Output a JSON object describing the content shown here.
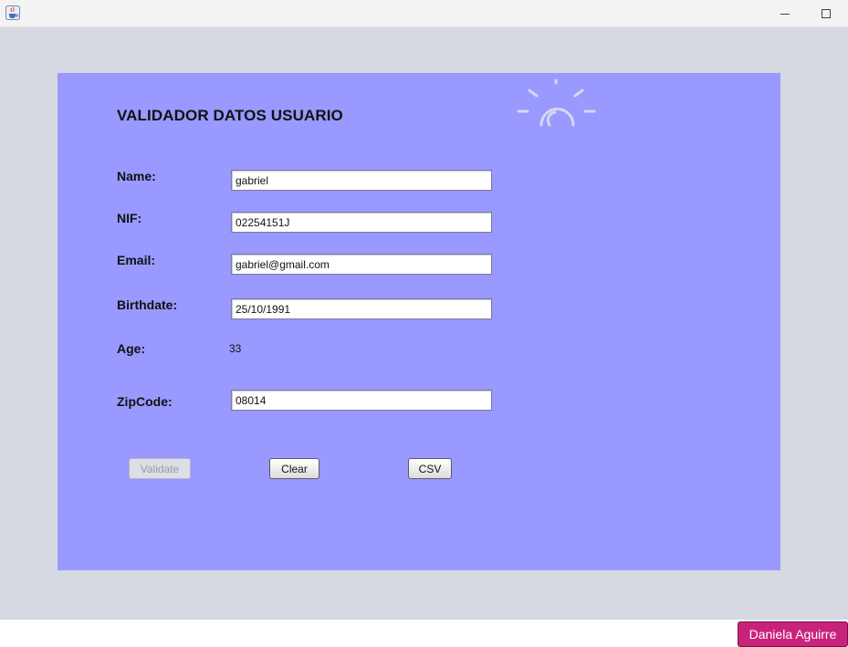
{
  "window": {
    "minimize_glyph": "minimize-icon",
    "maximize_glyph": "maximize-icon",
    "app_icon": "java-cup-icon"
  },
  "form": {
    "title": "VALIDADOR DATOS USUARIO",
    "decoration_icon": "lightbulb-icon",
    "name_label": "Name:",
    "name_value": "gabriel",
    "nif_label": "NIF:",
    "nif_value": "02254151J",
    "email_label": "Email:",
    "email_value": "gabriel@gmail.com",
    "birthdate_label": "Birthdate:",
    "birthdate_value": "25/10/1991",
    "age_label": "Age:",
    "age_value": "33",
    "zipcode_label": "ZipCode:",
    "zipcode_value": "08014"
  },
  "buttons": {
    "validate_label": "Validate",
    "validate_enabled": false,
    "clear_label": "Clear",
    "csv_label": "CSV"
  },
  "taskbar": {
    "user_name": "Daniela Aguirre"
  },
  "colors": {
    "panel": "#9999ff",
    "window_background": "#d6d9e1",
    "user_badge": "#c8237a"
  }
}
